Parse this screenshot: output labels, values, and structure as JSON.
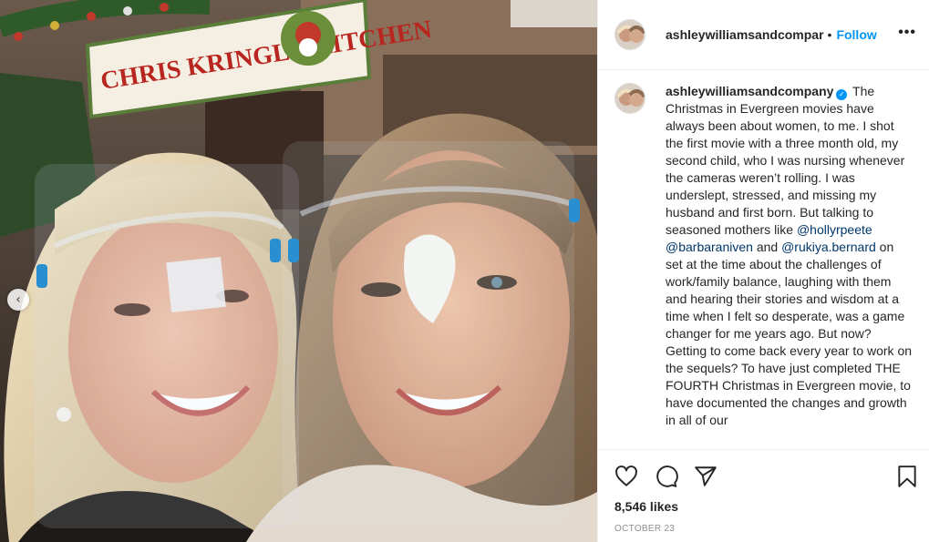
{
  "photo": {
    "sign_text": "CHRIS KRINGLE KITCHEN",
    "colors": {
      "sign_bg": "#f4efe2",
      "sign_text": "#b8261f",
      "sign_border": "#5a7d3a"
    }
  },
  "post": {
    "username": "ashleywilliamsandcompany",
    "header_username": "ashleywilliamsandcompar",
    "separator": "•",
    "follow_label": "Follow",
    "more_label": "•••",
    "verified_mark": "✓",
    "caption": {
      "part1": "The Christmas in Evergreen movies have always been about women, to me. I shot the first movie with a three month old, my second child, who I was nursing whenever the cameras weren’t rolling. I was underslept, stressed, and missing my husband and first born. But talking to seasoned mothers like ",
      "mention1": "@hollyrpeete",
      "sep1": " ",
      "mention2": "@barbaraniven",
      "sep2": " and ",
      "mention3": "@rukiya.bernard",
      "part2": " on set at the time about the challenges of work/family balance, laughing with them and hearing their stories and wisdom at a time when I felt so desperate, was a game changer for me years ago. But now? Getting to come back every year to work on the sequels? To have just completed THE FOURTH Christmas in Evergreen movie, to have documented the changes and growth in all of our"
    },
    "likes": "8,546 likes",
    "date": "OCTOBER 23",
    "icons": [
      "heart-icon",
      "comment-icon",
      "share-icon",
      "bookmark-icon",
      "chevron-left-icon",
      "more-icon"
    ],
    "colors": {
      "accent": "#0095f6",
      "mention": "#00376b",
      "muted": "#8e8e8e"
    }
  }
}
